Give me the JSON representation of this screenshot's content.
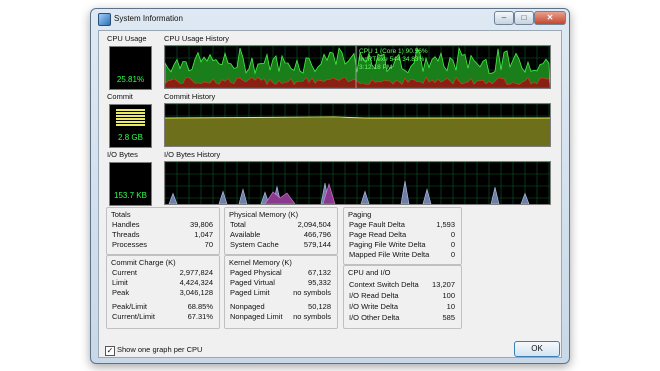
{
  "window": {
    "title": "System Information",
    "buttons": {
      "minimize": "–",
      "maximize": "□",
      "close": "✕"
    }
  },
  "cpu_usage": {
    "label": "CPU Usage",
    "value": "25.81%"
  },
  "cpu_history": {
    "label": "CPU Usage History",
    "tooltip": [
      "CPU 1 (Core 1) 90.56%",
      "IncRT.exe 544 34.83%",
      "3:12:18 PM"
    ]
  },
  "commit": {
    "label": "Commit",
    "value": "2.8 GB"
  },
  "commit_history": {
    "label": "Commit History"
  },
  "io_bytes": {
    "label": "I/O Bytes",
    "value": "153.7  KB"
  },
  "io_history": {
    "label": "I/O Bytes History"
  },
  "totals": {
    "header": "Totals",
    "rows": [
      {
        "k": "Handles",
        "v": "39,806"
      },
      {
        "k": "Threads",
        "v": "1,047"
      },
      {
        "k": "Processes",
        "v": "70"
      }
    ]
  },
  "commit_charge": {
    "header": "Commit Charge (K)",
    "rows": [
      {
        "k": "Current",
        "v": "2,977,824"
      },
      {
        "k": "Limit",
        "v": "4,424,324"
      },
      {
        "k": "Peak",
        "v": "3,046,128"
      },
      {
        "k": "Peak/Limit",
        "v": "68.85%"
      },
      {
        "k": "Current/Limit",
        "v": "67.31%"
      }
    ]
  },
  "physical_memory": {
    "header": "Physical Memory (K)",
    "rows": [
      {
        "k": "Total",
        "v": "2,094,504"
      },
      {
        "k": "Available",
        "v": "466,796"
      },
      {
        "k": "System Cache",
        "v": "579,144"
      }
    ]
  },
  "kernel_memory": {
    "header": "Kernel Memory (K)",
    "rows": [
      {
        "k": "Paged Physical",
        "v": "67,132"
      },
      {
        "k": "Paged Virtual",
        "v": "95,332"
      },
      {
        "k": "Paged Limit",
        "v": "no symbols"
      },
      {
        "k": "Nonpaged",
        "v": "50,128"
      },
      {
        "k": "Nonpaged Limit",
        "v": "no symbols"
      }
    ]
  },
  "paging": {
    "header": "Paging",
    "rows": [
      {
        "k": "Page Fault Delta",
        "v": "1,593"
      },
      {
        "k": "Page Read Delta",
        "v": "0"
      },
      {
        "k": "Paging File Write Delta",
        "v": "0"
      },
      {
        "k": "Mapped File Write Delta",
        "v": "0"
      }
    ]
  },
  "cpu_io": {
    "header": "CPU and I/O",
    "rows": [
      {
        "k": "Context Switch Delta",
        "v": "13,207"
      },
      {
        "k": "I/O Read Delta",
        "v": "100"
      },
      {
        "k": "I/O Write Delta",
        "v": "10"
      },
      {
        "k": "I/O Other Delta",
        "v": "585"
      }
    ]
  },
  "options": {
    "one_graph_per_cpu": "Show one graph per CPU",
    "checked_mark": "✓"
  },
  "ok_label": "OK"
}
